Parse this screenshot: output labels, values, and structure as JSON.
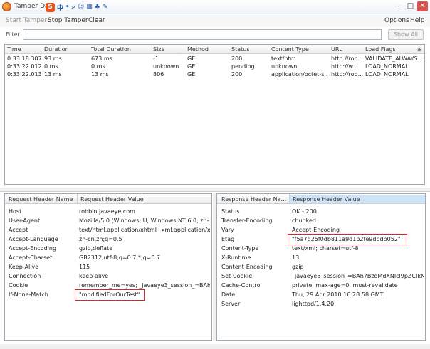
{
  "window": {
    "title": "Tamper Dat",
    "ime_glyphs": [
      "中",
      "•",
      "⌕",
      "☺",
      "▦",
      "♣",
      "✎"
    ],
    "ime_badge": "S",
    "minimize": "–",
    "maximize": "□",
    "close": "✕"
  },
  "toolbar": {
    "start": "Start Tamper",
    "stop": "Stop Tamper",
    "clear": "Clear",
    "options": "Options",
    "help": "Help"
  },
  "filter": {
    "label": "Filter",
    "value": "",
    "show_all": "Show All"
  },
  "requests": {
    "columns": [
      "Time",
      "Duration",
      "Total Duration",
      "Size",
      "Method",
      "Status",
      "Content Type",
      "URL",
      "Load Flags"
    ],
    "rows": [
      [
        "0:33:18.307",
        "93 ms",
        "673 ms",
        "-1",
        "GE",
        "200",
        "text/htm",
        "http://rob...",
        "VALIDATE_ALWAYS..."
      ],
      [
        "0:33:22.012",
        "0 ms",
        "0 ms",
        "unknown",
        "GE",
        "pending",
        "unknown",
        "http://w...",
        "LOAD_NORMAL"
      ],
      [
        "0:33:22.013",
        "13 ms",
        "13 ms",
        "806",
        "GE",
        "200",
        "application/octet-s...",
        "http://rob...",
        "LOAD_NORMAL"
      ]
    ]
  },
  "request_headers": {
    "col_name": "Request Header Name",
    "col_value": "Request Header Value",
    "rows": [
      [
        "Host",
        "robbin.javaeye.com"
      ],
      [
        "User-Agent",
        "Mozilla/5.0 (Windows; U; Windows NT 6.0; zh-..."
      ],
      [
        "Accept",
        "text/html,application/xhtml+xml,application/x..."
      ],
      [
        "Accept-Language",
        "zh-cn,zh;q=0.5"
      ],
      [
        "Accept-Encoding",
        "gzip,deflate"
      ],
      [
        "Accept-Charset",
        "GB2312,utf-8;q=0.7,*;q=0.7"
      ],
      [
        "Keep-Alive",
        "115"
      ],
      [
        "Connection",
        "keep-alive"
      ],
      [
        "Cookie",
        "remember_me=yes; _javaeye3_session_=BAh7..."
      ],
      [
        "If-None-Match",
        "\"modifiedForOurTest\""
      ]
    ]
  },
  "response_headers": {
    "col_name": "Response Header Na...",
    "col_value": "Response Header Value",
    "rows": [
      [
        "Status",
        "OK - 200"
      ],
      [
        "Transfer-Encoding",
        "chunked"
      ],
      [
        "Vary",
        "Accept-Encoding"
      ],
      [
        "Etag",
        "\"f5a7d25f0db811a9d1b2fe9dbdb052\""
      ],
      [
        "Content-Type",
        "text/xml; charset=utf-8"
      ],
      [
        "X-Runtime",
        "13"
      ],
      [
        "Content-Encoding",
        "gzip"
      ],
      [
        "Set-Cookie",
        "_javaeye3_session_=BAh7BzoMdXNlcl9pZCIkMDI..."
      ],
      [
        "Cache-Control",
        "private, max-age=0, must-revalidate"
      ],
      [
        "Date",
        "Thu, 29 Apr 2010 16:28:58 GMT"
      ],
      [
        "Server",
        "lighttpd/1.4.20"
      ]
    ]
  },
  "colors": {
    "highlight_border": "#dd2222",
    "selected_header": "#cfe3f7"
  }
}
